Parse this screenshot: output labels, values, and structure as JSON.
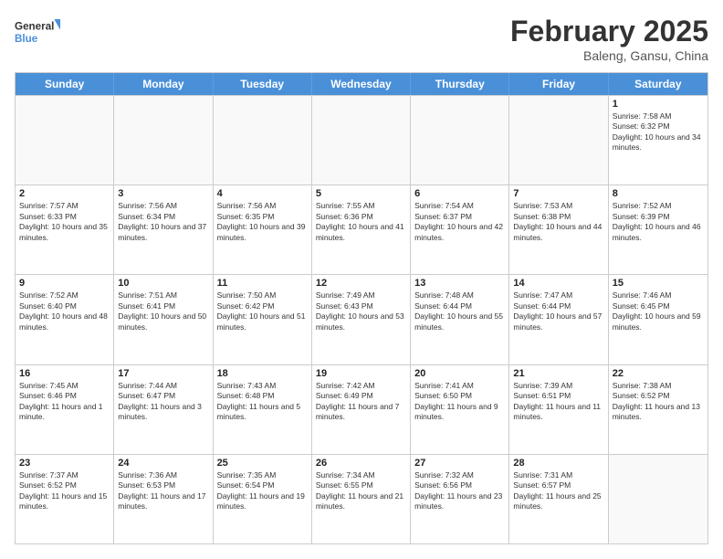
{
  "logo": {
    "line1": "General",
    "line2": "Blue"
  },
  "title": "February 2025",
  "subtitle": "Baleng, Gansu, China",
  "headers": [
    "Sunday",
    "Monday",
    "Tuesday",
    "Wednesday",
    "Thursday",
    "Friday",
    "Saturday"
  ],
  "weeks": [
    [
      {
        "day": "",
        "info": ""
      },
      {
        "day": "",
        "info": ""
      },
      {
        "day": "",
        "info": ""
      },
      {
        "day": "",
        "info": ""
      },
      {
        "day": "",
        "info": ""
      },
      {
        "day": "",
        "info": ""
      },
      {
        "day": "1",
        "info": "Sunrise: 7:58 AM\nSunset: 6:32 PM\nDaylight: 10 hours and 34 minutes."
      }
    ],
    [
      {
        "day": "2",
        "info": "Sunrise: 7:57 AM\nSunset: 6:33 PM\nDaylight: 10 hours and 35 minutes."
      },
      {
        "day": "3",
        "info": "Sunrise: 7:56 AM\nSunset: 6:34 PM\nDaylight: 10 hours and 37 minutes."
      },
      {
        "day": "4",
        "info": "Sunrise: 7:56 AM\nSunset: 6:35 PM\nDaylight: 10 hours and 39 minutes."
      },
      {
        "day": "5",
        "info": "Sunrise: 7:55 AM\nSunset: 6:36 PM\nDaylight: 10 hours and 41 minutes."
      },
      {
        "day": "6",
        "info": "Sunrise: 7:54 AM\nSunset: 6:37 PM\nDaylight: 10 hours and 42 minutes."
      },
      {
        "day": "7",
        "info": "Sunrise: 7:53 AM\nSunset: 6:38 PM\nDaylight: 10 hours and 44 minutes."
      },
      {
        "day": "8",
        "info": "Sunrise: 7:52 AM\nSunset: 6:39 PM\nDaylight: 10 hours and 46 minutes."
      }
    ],
    [
      {
        "day": "9",
        "info": "Sunrise: 7:52 AM\nSunset: 6:40 PM\nDaylight: 10 hours and 48 minutes."
      },
      {
        "day": "10",
        "info": "Sunrise: 7:51 AM\nSunset: 6:41 PM\nDaylight: 10 hours and 50 minutes."
      },
      {
        "day": "11",
        "info": "Sunrise: 7:50 AM\nSunset: 6:42 PM\nDaylight: 10 hours and 51 minutes."
      },
      {
        "day": "12",
        "info": "Sunrise: 7:49 AM\nSunset: 6:43 PM\nDaylight: 10 hours and 53 minutes."
      },
      {
        "day": "13",
        "info": "Sunrise: 7:48 AM\nSunset: 6:44 PM\nDaylight: 10 hours and 55 minutes."
      },
      {
        "day": "14",
        "info": "Sunrise: 7:47 AM\nSunset: 6:44 PM\nDaylight: 10 hours and 57 minutes."
      },
      {
        "day": "15",
        "info": "Sunrise: 7:46 AM\nSunset: 6:45 PM\nDaylight: 10 hours and 59 minutes."
      }
    ],
    [
      {
        "day": "16",
        "info": "Sunrise: 7:45 AM\nSunset: 6:46 PM\nDaylight: 11 hours and 1 minute."
      },
      {
        "day": "17",
        "info": "Sunrise: 7:44 AM\nSunset: 6:47 PM\nDaylight: 11 hours and 3 minutes."
      },
      {
        "day": "18",
        "info": "Sunrise: 7:43 AM\nSunset: 6:48 PM\nDaylight: 11 hours and 5 minutes."
      },
      {
        "day": "19",
        "info": "Sunrise: 7:42 AM\nSunset: 6:49 PM\nDaylight: 11 hours and 7 minutes."
      },
      {
        "day": "20",
        "info": "Sunrise: 7:41 AM\nSunset: 6:50 PM\nDaylight: 11 hours and 9 minutes."
      },
      {
        "day": "21",
        "info": "Sunrise: 7:39 AM\nSunset: 6:51 PM\nDaylight: 11 hours and 11 minutes."
      },
      {
        "day": "22",
        "info": "Sunrise: 7:38 AM\nSunset: 6:52 PM\nDaylight: 11 hours and 13 minutes."
      }
    ],
    [
      {
        "day": "23",
        "info": "Sunrise: 7:37 AM\nSunset: 6:52 PM\nDaylight: 11 hours and 15 minutes."
      },
      {
        "day": "24",
        "info": "Sunrise: 7:36 AM\nSunset: 6:53 PM\nDaylight: 11 hours and 17 minutes."
      },
      {
        "day": "25",
        "info": "Sunrise: 7:35 AM\nSunset: 6:54 PM\nDaylight: 11 hours and 19 minutes."
      },
      {
        "day": "26",
        "info": "Sunrise: 7:34 AM\nSunset: 6:55 PM\nDaylight: 11 hours and 21 minutes."
      },
      {
        "day": "27",
        "info": "Sunrise: 7:32 AM\nSunset: 6:56 PM\nDaylight: 11 hours and 23 minutes."
      },
      {
        "day": "28",
        "info": "Sunrise: 7:31 AM\nSunset: 6:57 PM\nDaylight: 11 hours and 25 minutes."
      },
      {
        "day": "",
        "info": ""
      }
    ]
  ]
}
